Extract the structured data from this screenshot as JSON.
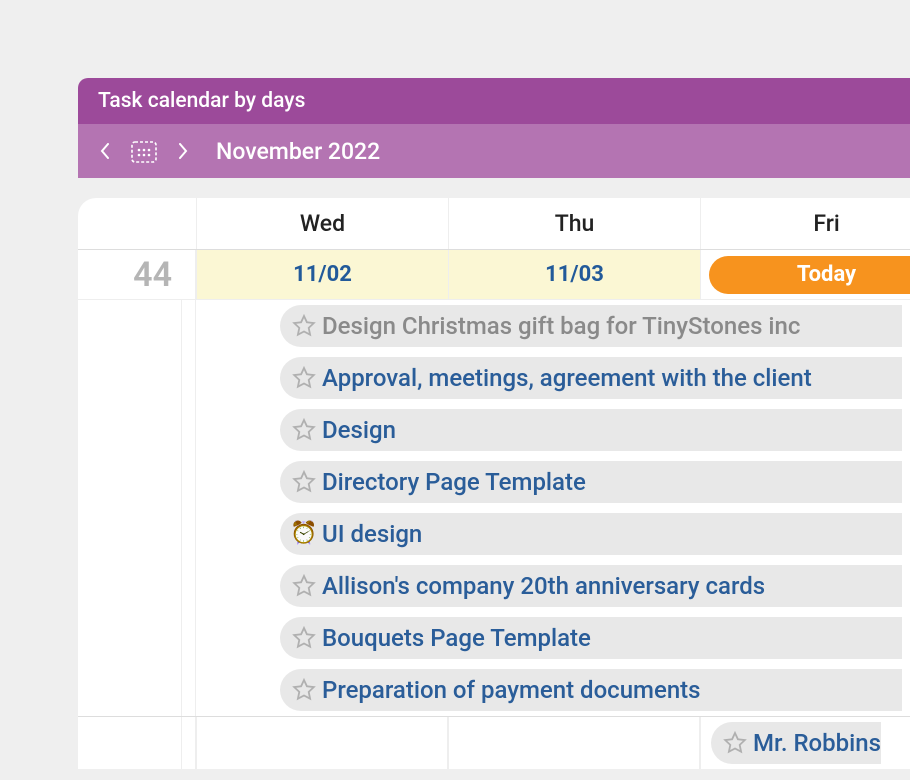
{
  "header": {
    "title": "Task calendar by days",
    "month_label": "November 2022"
  },
  "week_number": "44",
  "day_headers": [
    "Wed",
    "Thu",
    "Fri"
  ],
  "dates": [
    {
      "label": "11/02",
      "kind": "past"
    },
    {
      "label": "11/03",
      "kind": "past"
    },
    {
      "label": "Today",
      "kind": "today"
    }
  ],
  "tasks": [
    {
      "title": "Design Christmas gift bag for TinyStones inc",
      "style": "muted",
      "icon": "star"
    },
    {
      "title": "Approval, meetings, agreement with the client",
      "style": "link",
      "icon": "star"
    },
    {
      "title": "Design",
      "style": "link",
      "icon": "star"
    },
    {
      "title": "Directory Page Template",
      "style": "link",
      "icon": "star"
    },
    {
      "title": "UI design",
      "style": "link",
      "icon": "alarm"
    },
    {
      "title": "Allison's company 20th anniversary cards",
      "style": "link",
      "icon": "star"
    },
    {
      "title": "Bouquets Page Template",
      "style": "link",
      "icon": "star"
    },
    {
      "title": "Preparation of payment documents",
      "style": "link",
      "icon": "star"
    }
  ],
  "bottom_task": {
    "title": "Mr. Robbins",
    "style": "link",
    "icon": "star"
  }
}
